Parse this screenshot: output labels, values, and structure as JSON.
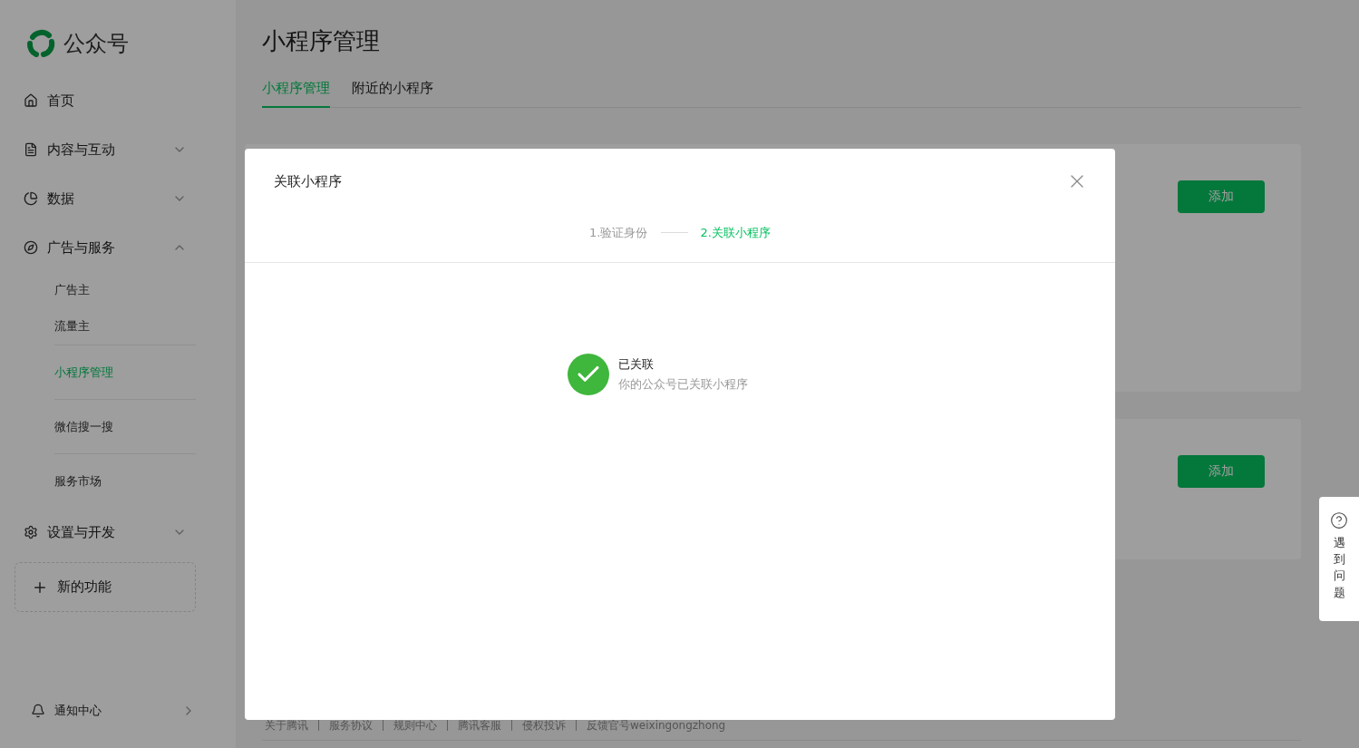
{
  "brand": {
    "name": "公众号"
  },
  "nav": [
    {
      "kind": "item",
      "label": "首页"
    },
    {
      "kind": "group",
      "label": "内容与互动",
      "expanded": false
    },
    {
      "kind": "group",
      "label": "数据",
      "expanded": false
    },
    {
      "kind": "group",
      "label": "广告与服务",
      "expanded": true,
      "children": [
        {
          "label": "广告主",
          "selected": false
        },
        {
          "label": "流量主",
          "selected": false
        },
        {
          "label": "小程序管理",
          "selected": true
        },
        {
          "label": "微信搜一搜",
          "selected": false
        },
        {
          "label": "服务市场",
          "selected": false
        }
      ]
    },
    {
      "kind": "group",
      "label": "设置与开发",
      "expanded": false
    }
  ],
  "new_feature": {
    "label": "新的功能"
  },
  "notification": {
    "label": "通知中心"
  },
  "page": {
    "title": "小程序管理",
    "tabs": [
      {
        "label": "小程序管理",
        "selected": true
      },
      {
        "label": "附近的小程序",
        "selected": false
      }
    ]
  },
  "cards": [
    {
      "button": "添加"
    },
    {
      "button": "添加"
    }
  ],
  "footer": {
    "links": [
      "关于腾讯",
      "服务协议",
      "规则中心",
      "腾讯客服",
      "侵权投诉",
      "反馈官号weixingongzhong"
    ]
  },
  "help": {
    "label": "遇到问题"
  },
  "dialog": {
    "title": "关联小程序",
    "steps": [
      {
        "label": "1.验证身份",
        "selected": false
      },
      {
        "label": "2.关联小程序",
        "selected": true
      }
    ],
    "result": {
      "title": "已关联",
      "description": "你的公众号已关联小程序"
    }
  }
}
